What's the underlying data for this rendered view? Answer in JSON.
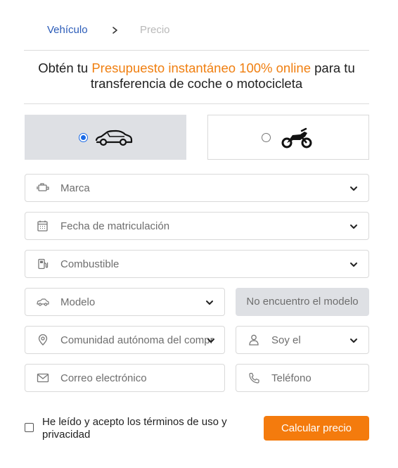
{
  "breadcrumb": {
    "step1": "Vehículo",
    "separator_icon": "chevron-right-icon",
    "step2": "Precio"
  },
  "headline": {
    "before": "Obtén tu ",
    "highlight": "Presupuesto instantáneo 100% online",
    "after": " para tu transferencia de coche o motocicleta"
  },
  "vehicle_type": {
    "options": [
      {
        "icon": "car-icon",
        "selected": true
      },
      {
        "icon": "motorcycle-icon",
        "selected": false
      }
    ]
  },
  "fields": {
    "marca": {
      "placeholder": "Marca",
      "icon": "engine-icon"
    },
    "fecha": {
      "placeholder": "Fecha de matriculación",
      "icon": "calendar-icon"
    },
    "combustible": {
      "placeholder": "Combustible",
      "icon": "fuel-pump-icon"
    },
    "modelo": {
      "placeholder": "Modelo",
      "icon": "car-icon"
    },
    "comunidad": {
      "placeholder": "Comunidad autónoma del compra",
      "icon": "location-pin-icon"
    },
    "soy": {
      "placeholder": "Soy el",
      "icon": "user-icon"
    },
    "correo": {
      "placeholder": "Correo electrónico",
      "icon": "envelope-icon"
    },
    "telefono": {
      "placeholder": "Teléfono",
      "icon": "phone-icon"
    }
  },
  "no_model_button": "No encuentro el modelo",
  "terms": {
    "label": "He leído y acepto los términos de uso y privacidad",
    "checked": false
  },
  "submit_button": "Calcular precio",
  "colors": {
    "accent_orange": "#f47b0d",
    "breadcrumb_blue": "#2a5bb8",
    "radio_blue": "#1a6ae6",
    "selected_card": "#dee0e4"
  }
}
